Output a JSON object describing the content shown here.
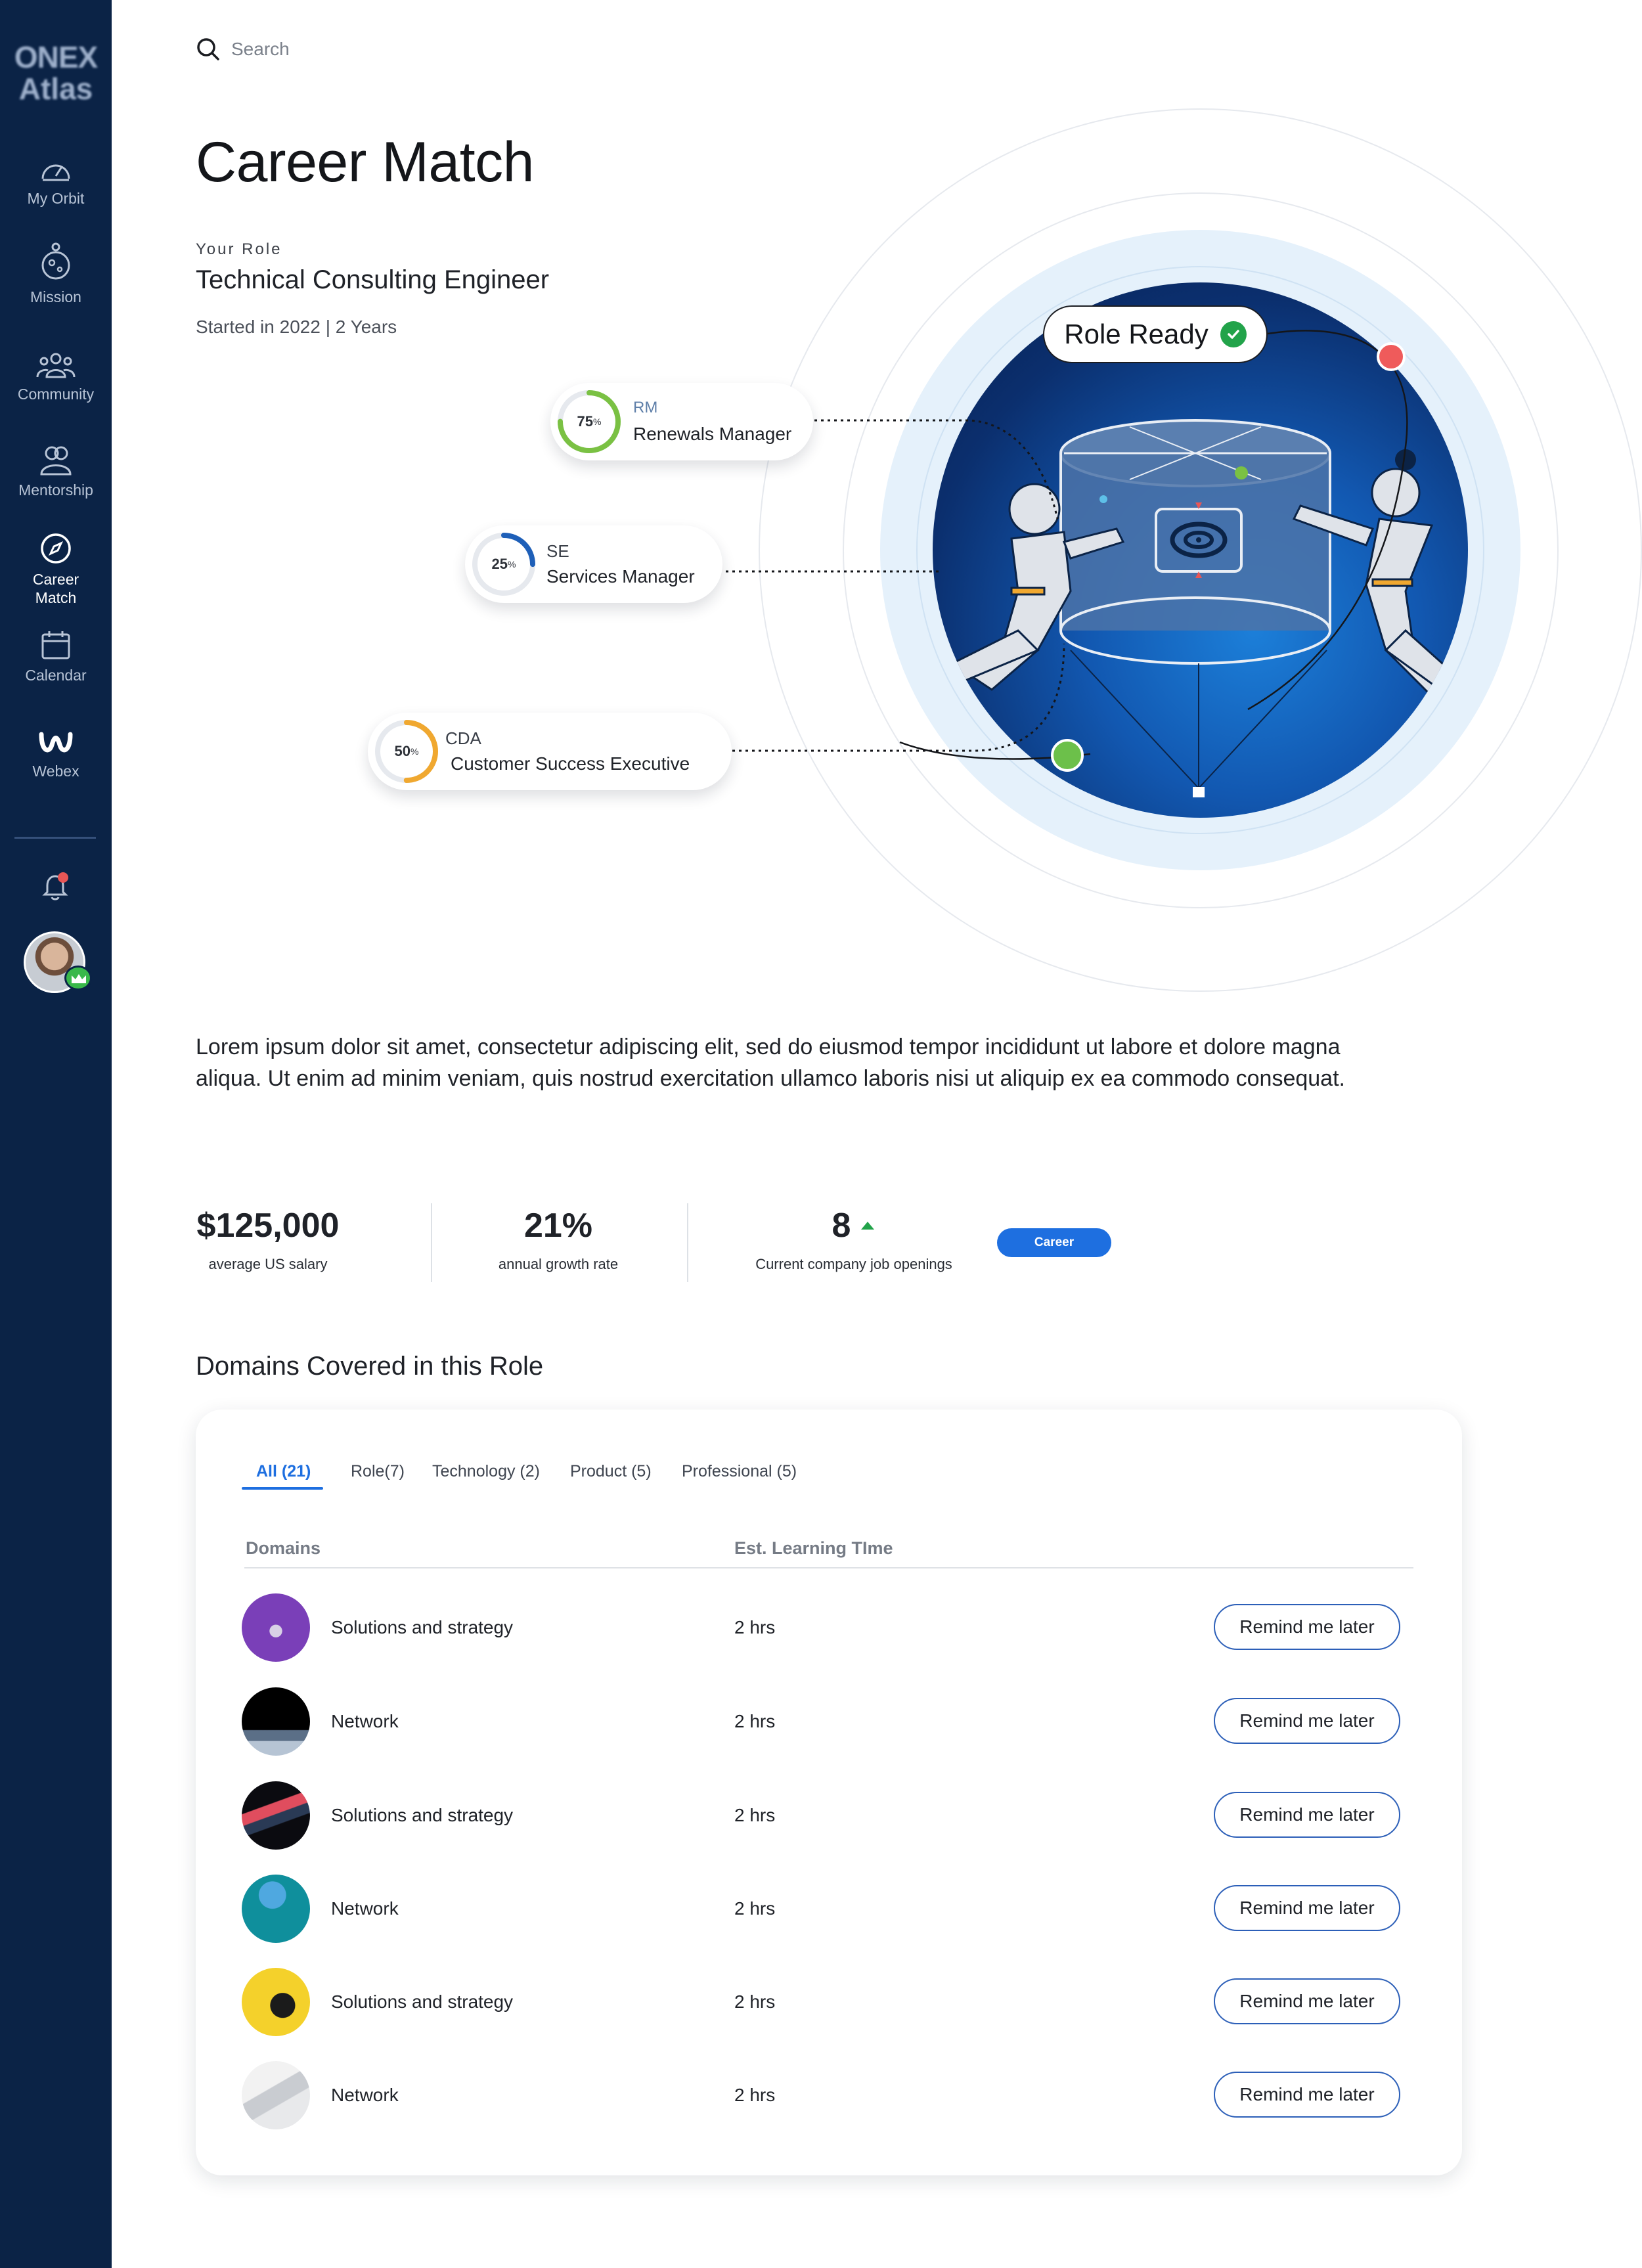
{
  "sidebar": {
    "logo_line1": "ONEX",
    "logo_line2": "Atlas",
    "items": [
      {
        "label": "My Orbit",
        "icon": "gauge-icon"
      },
      {
        "label": "Mission",
        "icon": "planet-icon"
      },
      {
        "label": "Community",
        "icon": "community-icon"
      },
      {
        "label": "Mentorship",
        "icon": "mentorship-icon"
      },
      {
        "label": "Career Match",
        "icon": "compass-icon",
        "active": true
      },
      {
        "label": "Calendar",
        "icon": "calendar-icon"
      },
      {
        "label": "Webex",
        "icon": "webex-icon"
      }
    ]
  },
  "search": {
    "placeholder": "Search"
  },
  "page": {
    "title": "Career Match",
    "role_label": "Your Role",
    "role_title": "Technical Consulting Engineer",
    "role_meta": "Started in 2022 | 2 Years"
  },
  "illustration": {
    "badge": "Role Ready",
    "matches": [
      {
        "abbr": "RM",
        "name": "Renewals Manager",
        "percent": 75,
        "pct_label": "75",
        "color": "#7ac143"
      },
      {
        "abbr": "SE",
        "name": "Services Manager",
        "percent": 25,
        "pct_label": "25",
        "color": "#1e5fb8"
      },
      {
        "abbr": "CDA",
        "name": "Customer Success Executive",
        "percent": 50,
        "pct_label": "50",
        "color": "#f0a830"
      }
    ]
  },
  "description": "Lorem ipsum dolor sit amet, consectetur adipiscing elit, sed do eiusmod tempor incididunt ut labore et dolore magna aliqua. Ut enim ad minim veniam, quis nostrud exercitation ullamco laboris nisi ut aliquip ex ea commodo consequat.",
  "stats": {
    "salary_value": "$125,000",
    "salary_label": "average US salary",
    "growth_value": "21%",
    "growth_label": "annual growth rate",
    "openings_value": "8",
    "openings_label": "Current company job openings",
    "career_button": "Career"
  },
  "domains": {
    "title": "Domains Covered in this Role",
    "tabs": [
      "All (21)",
      "Role(7)",
      "Technology (2)",
      "Product (5)",
      "Professional (5)"
    ],
    "col_domains": "Domains",
    "col_time": "Est. Learning TIme",
    "rows": [
      {
        "name": "Solutions and strategy",
        "time": "2 hrs",
        "action": "Remind me later"
      },
      {
        "name": "Network",
        "time": "2 hrs",
        "action": "Remind me later"
      },
      {
        "name": "Solutions and strategy",
        "time": "2 hrs",
        "action": "Remind me later"
      },
      {
        "name": "Network",
        "time": "2 hrs",
        "action": "Remind me later"
      },
      {
        "name": "Solutions and strategy",
        "time": "2 hrs",
        "action": "Remind me later"
      },
      {
        "name": "Network",
        "time": "2 hrs",
        "action": "Remind me later"
      }
    ]
  },
  "colors": {
    "sidebar_bg": "#0b2346",
    "accent": "#1e6fe0",
    "role_ready_check": "#22a34a",
    "openings_arrow": "#22a34a"
  }
}
